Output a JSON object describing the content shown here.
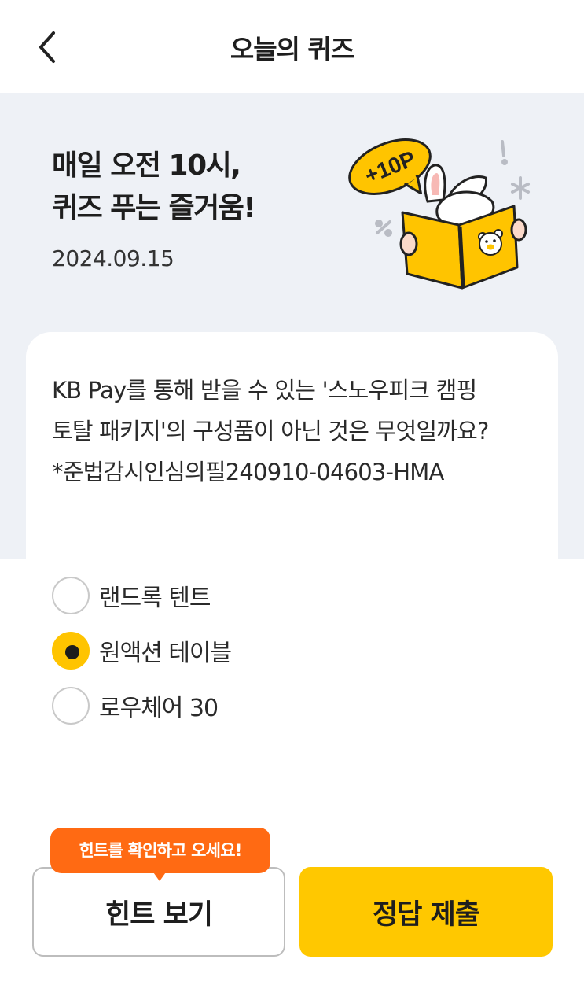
{
  "header": {
    "title": "오늘의 퀴즈",
    "back_icon": "chevron-left-icon"
  },
  "hero": {
    "title_line1": "매일 오전 10시,",
    "title_line2": "퀴즈 푸는 즐거움!",
    "date": "2024.09.15",
    "badge": "+10P",
    "illustration": "bunny-reading-book"
  },
  "quiz": {
    "question": "KB Pay를 통해 받을 수 있는 '스노우피크 캠핑 토탈 패키지'의 구성품이 아닌 것은 무엇일까요? *준법감시인심의필240910-04603-HMA",
    "options": [
      {
        "label": "랜드록 텐트",
        "selected": false
      },
      {
        "label": "원액션 테이블",
        "selected": true
      },
      {
        "label": "로우체어 30",
        "selected": false
      }
    ]
  },
  "footer": {
    "tooltip": "힌트를 확인하고 오세요!",
    "hint_button": "힌트 보기",
    "submit_button": "정답 제출"
  },
  "colors": {
    "accent": "#ffc800",
    "tooltip": "#ff6a13",
    "hero_bg": "#eef1f6"
  }
}
